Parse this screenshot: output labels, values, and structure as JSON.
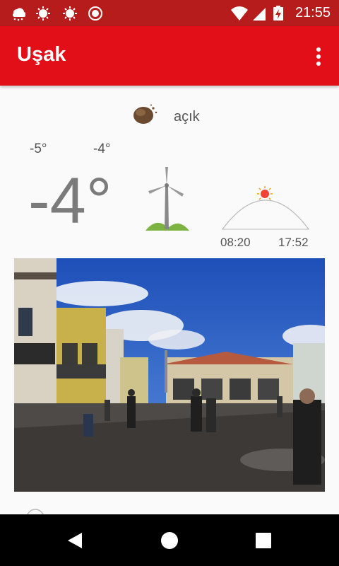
{
  "status_bar": {
    "time": "21:55",
    "icons": [
      "weather-snow-icon",
      "sun-icon",
      "sun-icon",
      "record-icon",
      "wifi-icon",
      "signal-icon",
      "battery-charging-icon"
    ]
  },
  "app_bar": {
    "title": "Uşak",
    "menu_icon": "more-vert-icon"
  },
  "weather": {
    "condition": "açık",
    "condition_icon": "moon-night-icon",
    "temp_low": "-5°",
    "temp_high": "-4°",
    "temp_current": "-4°",
    "wind_icon": "wind-turbine-icon",
    "sunrise": "08:20",
    "sunset": "17:52"
  },
  "photo": {
    "description_icon": "city-street-photo"
  },
  "navigation": {
    "icons": [
      "back-icon",
      "home-icon",
      "recents-icon"
    ]
  },
  "colors": {
    "app_bar": "#e30f18",
    "status_bar": "#b71c1c"
  }
}
